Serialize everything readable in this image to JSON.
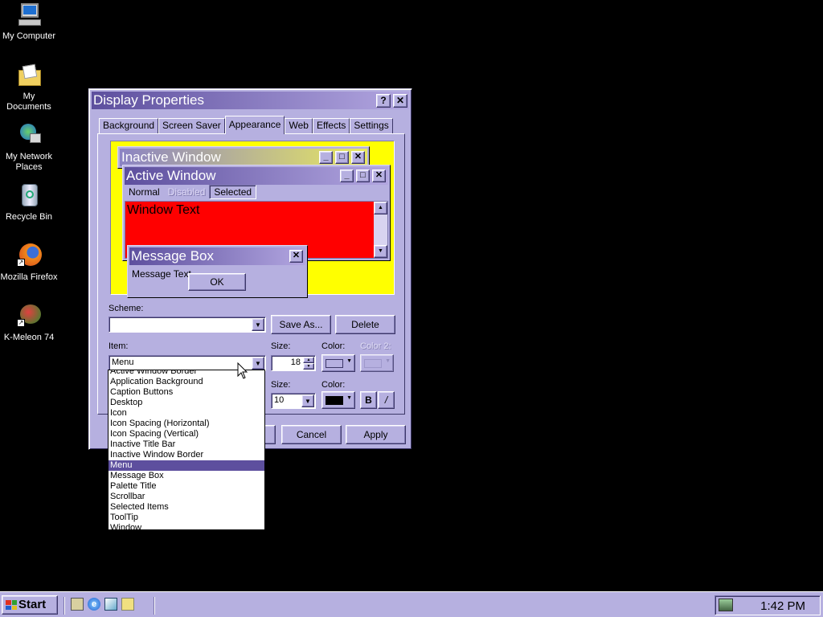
{
  "desktop": {
    "icons": [
      {
        "label1": "My Computer",
        "label2": "",
        "icon": "computer-icon"
      },
      {
        "label1": "My Documents",
        "label2": "",
        "icon": "folder-icon"
      },
      {
        "label1": "My Network",
        "label2": "Places",
        "icon": "network-icon"
      },
      {
        "label1": "Recycle Bin",
        "label2": "",
        "icon": "recycle-bin-icon"
      },
      {
        "label1": "Mozilla Firefox",
        "label2": "",
        "icon": "firefox-icon"
      },
      {
        "label1": "K-Meleon 74",
        "label2": "",
        "icon": "kmeleon-icon"
      }
    ]
  },
  "dialog": {
    "title": "Display Properties",
    "help_label": "?",
    "close_label": "✕",
    "tabs": [
      "Background",
      "Screen Saver",
      "Appearance",
      "Web",
      "Effects",
      "Settings"
    ],
    "selected_tab": "Appearance",
    "preview": {
      "inactive_title": "Inactive Window",
      "active_title": "Active Window",
      "menu_normal": "Normal",
      "menu_disabled": "Disabled",
      "menu_selected": "Selected",
      "window_text": "Window Text",
      "msgbox_title": "Message Box",
      "msgbox_text": "Message Text",
      "ok_label": "OK"
    },
    "scheme": {
      "label": "Scheme:",
      "value": "",
      "save_as": "Save As...",
      "delete": "Delete"
    },
    "item": {
      "label": "Item:",
      "value": "Menu",
      "size_label": "Size:",
      "size_value": "18",
      "color_label": "Color:",
      "color2_label": "Color 2:"
    },
    "font": {
      "size_label": "Size:",
      "size_value": "10",
      "color_label": "Color:",
      "bold": "B",
      "italic": "/"
    },
    "buttons": {
      "cancel": "Cancel",
      "apply": "Apply"
    },
    "dropdown_items": [
      "Active Window Border",
      "Application Background",
      "Caption Buttons",
      "Desktop",
      "Icon",
      "Icon Spacing (Horizontal)",
      "Icon Spacing (Vertical)",
      "Inactive Title Bar",
      "Inactive Window Border",
      "Menu",
      "Message Box",
      "Palette Title",
      "Scrollbar",
      "Selected Items",
      "ToolTip",
      "Window"
    ],
    "dropdown_selected": "Menu"
  },
  "taskbar": {
    "start_label": "Start",
    "clock": "1:42 PM",
    "quicklaunch": [
      "show-desktop-icon",
      "internet-explorer-icon",
      "outlook-express-icon",
      "search-icon"
    ]
  },
  "colors": {
    "face": "#b6b0e0",
    "title_active_start": "#5d4f9e",
    "title_inactive_start": "#8b83c4",
    "preview_bg": "#ffff00",
    "window_bg": "#ff0000",
    "selection": "#5d4f9e"
  }
}
